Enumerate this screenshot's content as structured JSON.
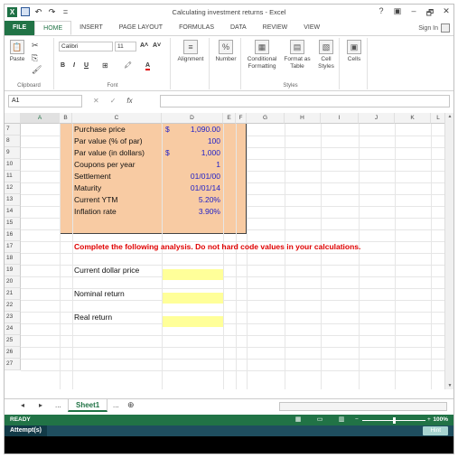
{
  "window": {
    "title": "Calculating investment returns - Excel",
    "controls": [
      "?",
      "▣",
      "–",
      "🗗",
      "✕"
    ]
  },
  "qat": {
    "undo": "↶",
    "redo": "↷",
    "more": "="
  },
  "tabs": [
    "FILE",
    "HOME",
    "INSERT",
    "PAGE LAYOUT",
    "FORMULAS",
    "DATA",
    "REVIEW",
    "VIEW"
  ],
  "sign_in": "Sign In",
  "ribbon": {
    "paste": "Paste",
    "clipboard_label": "Clipboard",
    "font_name": "Calibri",
    "font_size": "11",
    "bold": "B",
    "italic": "I",
    "underline": "U",
    "font_label": "Font",
    "alignment": "Alignment",
    "number": "Number",
    "conditional": "Conditional Formatting",
    "format_table": "Format as Table",
    "cell_styles": "Cell Styles",
    "cells": "Cells",
    "styles_label": "Styles",
    "grow_font": "A˄",
    "shrink_font": "A˅",
    "fill_color": "🖍",
    "font_color": "A",
    "percent": "%"
  },
  "formula_bar": {
    "name_box": "A1",
    "cancel": "✕",
    "enter": "✓",
    "fx": "fx",
    "formula": ""
  },
  "columns": [
    "A",
    "B",
    "C",
    "D",
    "E",
    "F",
    "G",
    "H",
    "I",
    "J",
    "K",
    "L"
  ],
  "rows": [
    "7",
    "8",
    "9",
    "10",
    "11",
    "12",
    "13",
    "14",
    "15",
    "16",
    "17",
    "18",
    "19",
    "20",
    "21",
    "22",
    "23",
    "24",
    "25",
    "26",
    "27"
  ],
  "inputs": [
    {
      "label": "Purchase price",
      "currency": "$",
      "value": "1,090.00"
    },
    {
      "label": "Par value (% of par)",
      "currency": "",
      "value": "100"
    },
    {
      "label": "Par value (in dollars)",
      "currency": "$",
      "value": "1,000"
    },
    {
      "label": "Coupons per year",
      "currency": "",
      "value": "1"
    },
    {
      "label": "Settlement",
      "currency": "",
      "value": "01/01/00"
    },
    {
      "label": "Maturity",
      "currency": "",
      "value": "01/01/14"
    },
    {
      "label": "Current YTM",
      "currency": "",
      "value": "5.20%"
    },
    {
      "label": "Inflation rate",
      "currency": "",
      "value": "3.90%"
    }
  ],
  "instruction": "Complete the following analysis. Do not hard code values in your calculations.",
  "analysis": {
    "current_dollar_price": "Current dollar price",
    "nominal_return": "Nominal return",
    "real_return": "Real return"
  },
  "sheet": {
    "prev": "◂",
    "next": "▸",
    "ellipsis": "...",
    "name": "Sheet1",
    "ellipsis2": "...",
    "add": "⊕"
  },
  "status": {
    "ready": "READY",
    "zoom": "100%",
    "zoom_minus": "−",
    "zoom_plus": "+"
  },
  "attempt": {
    "label": "Attempt(s)",
    "hint": "Hint"
  }
}
